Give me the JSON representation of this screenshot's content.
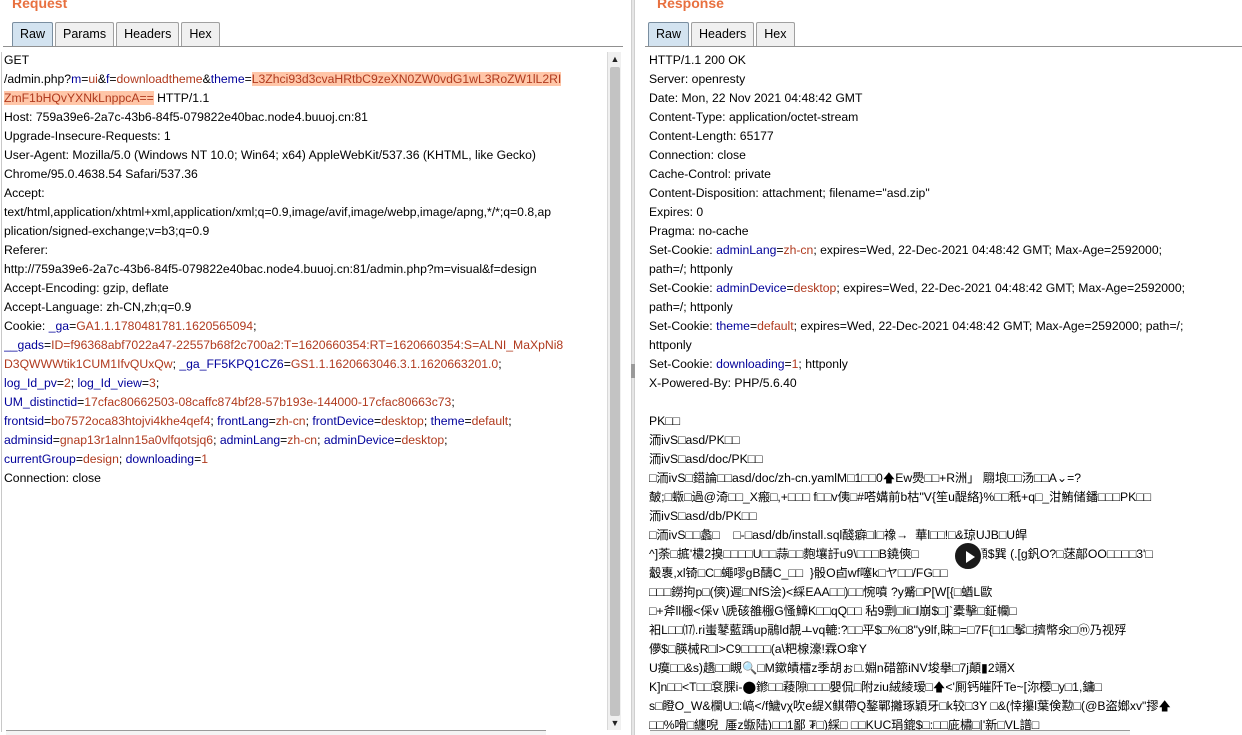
{
  "request": {
    "title": "Request",
    "tabs": [
      "Raw",
      "Params",
      "Headers",
      "Hex"
    ],
    "lines": [
      [
        {
          "t": "GET"
        }
      ],
      [
        {
          "t": "/admin.php?"
        },
        {
          "t": "m",
          "c": "k"
        },
        {
          "t": "="
        },
        {
          "t": "ui",
          "c": "v"
        },
        {
          "t": "&"
        },
        {
          "t": "f",
          "c": "k"
        },
        {
          "t": "="
        },
        {
          "t": "downloadtheme",
          "c": "v"
        },
        {
          "t": "&"
        },
        {
          "t": "theme",
          "c": "k"
        },
        {
          "t": "="
        },
        {
          "t": "L3Zhci93d3cvaHRtbC9zeXN0ZW0vdG1wL3RoZW1lL2RI",
          "c": "v hl"
        }
      ],
      [
        {
          "t": "ZmF1bHQvYXNkLnppcA==",
          "c": "v hl"
        },
        {
          "t": " HTTP/1.1"
        }
      ],
      [
        {
          "t": "Host: 759a39e6-2a7c-43b6-84f5-079822e40bac.node4.buuoj.cn:81"
        }
      ],
      [
        {
          "t": "Upgrade-Insecure-Requests: 1"
        }
      ],
      [
        {
          "t": "User-Agent: Mozilla/5.0 (Windows NT 10.0; Win64; x64) AppleWebKit/537.36 (KHTML, like Gecko)"
        }
      ],
      [
        {
          "t": "Chrome/95.0.4638.54 Safari/537.36"
        }
      ],
      [
        {
          "t": "Accept:"
        }
      ],
      [
        {
          "t": "text/html,application/xhtml+xml,application/xml;q=0.9,image/avif,image/webp,image/apng,*/*;q=0.8,ap"
        }
      ],
      [
        {
          "t": "plication/signed-exchange;v=b3;q=0.9"
        }
      ],
      [
        {
          "t": "Referer:"
        }
      ],
      [
        {
          "t": "http://759a39e6-2a7c-43b6-84f5-079822e40bac.node4.buuoj.cn:81/admin.php?m=visual&f=design"
        }
      ],
      [
        {
          "t": "Accept-Encoding: gzip, deflate"
        }
      ],
      [
        {
          "t": "Accept-Language: zh-CN,zh;q=0.9"
        }
      ],
      [
        {
          "t": "Cookie: "
        },
        {
          "t": "_ga",
          "c": "k"
        },
        {
          "t": "="
        },
        {
          "t": "GA1.1.1780481781.1620565094",
          "c": "v"
        },
        {
          "t": ";"
        }
      ],
      [
        {
          "t": "__gads",
          "c": "k"
        },
        {
          "t": "="
        },
        {
          "t": "ID=f96368abf7022a47-22557b68f2c700a2:T=1620660354:RT=1620660354:S=ALNI_MaXpNi8",
          "c": "v"
        }
      ],
      [
        {
          "t": "D3QWWWtik1CUM1IfvQUxQw",
          "c": "v"
        },
        {
          "t": "; "
        },
        {
          "t": "_ga_FF5KPQ1CZ6",
          "c": "k"
        },
        {
          "t": "="
        },
        {
          "t": "GS1.1.1620663046.3.1.1620663201.0",
          "c": "v"
        },
        {
          "t": ";"
        }
      ],
      [
        {
          "t": "log_Id_pv",
          "c": "k"
        },
        {
          "t": "="
        },
        {
          "t": "2",
          "c": "v"
        },
        {
          "t": "; "
        },
        {
          "t": "log_Id_view",
          "c": "k"
        },
        {
          "t": "="
        },
        {
          "t": "3",
          "c": "v"
        },
        {
          "t": ";"
        }
      ],
      [
        {
          "t": "UM_distinctid",
          "c": "k"
        },
        {
          "t": "="
        },
        {
          "t": "17cfac80662503-08caffc874bf28-57b193e-144000-17cfac80663c73",
          "c": "v"
        },
        {
          "t": ";"
        }
      ],
      [
        {
          "t": "frontsid",
          "c": "k"
        },
        {
          "t": "="
        },
        {
          "t": "bo7572oca83htojvi4khe4qef4",
          "c": "v"
        },
        {
          "t": "; "
        },
        {
          "t": "frontLang",
          "c": "k"
        },
        {
          "t": "="
        },
        {
          "t": "zh-cn",
          "c": "v"
        },
        {
          "t": "; "
        },
        {
          "t": "frontDevice",
          "c": "k"
        },
        {
          "t": "="
        },
        {
          "t": "desktop",
          "c": "v"
        },
        {
          "t": "; "
        },
        {
          "t": "theme",
          "c": "k"
        },
        {
          "t": "="
        },
        {
          "t": "default",
          "c": "v"
        },
        {
          "t": ";"
        }
      ],
      [
        {
          "t": "adminsid",
          "c": "k"
        },
        {
          "t": "="
        },
        {
          "t": "gnap13r1alnn15a0vlfqotsjq6",
          "c": "v"
        },
        {
          "t": "; "
        },
        {
          "t": "adminLang",
          "c": "k"
        },
        {
          "t": "="
        },
        {
          "t": "zh-cn",
          "c": "v"
        },
        {
          "t": "; "
        },
        {
          "t": "adminDevice",
          "c": "k"
        },
        {
          "t": "="
        },
        {
          "t": "desktop",
          "c": "v"
        },
        {
          "t": ";"
        }
      ],
      [
        {
          "t": "currentGroup",
          "c": "k"
        },
        {
          "t": "="
        },
        {
          "t": "design",
          "c": "v"
        },
        {
          "t": "; "
        },
        {
          "t": "downloading",
          "c": "k"
        },
        {
          "t": "="
        },
        {
          "t": "1",
          "c": "v"
        }
      ],
      [
        {
          "t": "Connection: close"
        }
      ]
    ]
  },
  "response": {
    "title": "Response",
    "tabs": [
      "Raw",
      "Headers",
      "Hex"
    ],
    "lines": [
      [
        {
          "t": "HTTP/1.1 200 OK"
        }
      ],
      [
        {
          "t": "Server: openresty"
        }
      ],
      [
        {
          "t": "Date: Mon, 22 Nov 2021 04:48:42 GMT"
        }
      ],
      [
        {
          "t": "Content-Type: application/octet-stream"
        }
      ],
      [
        {
          "t": "Content-Length: 65177"
        }
      ],
      [
        {
          "t": "Connection: close"
        }
      ],
      [
        {
          "t": "Cache-Control: private"
        }
      ],
      [
        {
          "t": "Content-Disposition: attachment; filename=\"asd.zip\""
        }
      ],
      [
        {
          "t": "Expires: 0"
        }
      ],
      [
        {
          "t": "Pragma: no-cache"
        }
      ],
      [
        {
          "t": "Set-Cookie: "
        },
        {
          "t": "adminLang",
          "c": "k"
        },
        {
          "t": "="
        },
        {
          "t": "zh-cn",
          "c": "v"
        },
        {
          "t": "; expires=Wed, 22-Dec-2021 04:48:42 GMT; Max-Age=2592000;"
        }
      ],
      [
        {
          "t": "path=/; httponly"
        }
      ],
      [
        {
          "t": "Set-Cookie: "
        },
        {
          "t": "adminDevice",
          "c": "k"
        },
        {
          "t": "="
        },
        {
          "t": "desktop",
          "c": "v"
        },
        {
          "t": "; expires=Wed, 22-Dec-2021 04:48:42 GMT; Max-Age=2592000;"
        }
      ],
      [
        {
          "t": "path=/; httponly"
        }
      ],
      [
        {
          "t": "Set-Cookie: "
        },
        {
          "t": "theme",
          "c": "k"
        },
        {
          "t": "="
        },
        {
          "t": "default",
          "c": "v"
        },
        {
          "t": "; expires=Wed, 22-Dec-2021 04:48:42 GMT; Max-Age=2592000; path=/;"
        }
      ],
      [
        {
          "t": "httponly"
        }
      ],
      [
        {
          "t": "Set-Cookie: "
        },
        {
          "t": "downloading",
          "c": "k"
        },
        {
          "t": "="
        },
        {
          "t": "1",
          "c": "v"
        },
        {
          "t": "; httponly"
        }
      ],
      [
        {
          "t": "X-Powered-By: PHP/5.6.40"
        }
      ],
      [
        {
          "t": ""
        }
      ],
      [
        {
          "t": "PK□□"
        }
      ],
      [
        {
          "t": "洏ivS□asd/PK□□"
        }
      ],
      [
        {
          "t": "洏ivS□asd/doc/PK□□"
        }
      ],
      [
        {
          "t": "□洏ivS□鍣論□□asd/doc/zh-cn.yamlM□1□□0🡅Ew爂□□+R洲」 翢埌□□汤□□A⌄=?"
        }
      ],
      [
        {
          "t": "皶;□蝂□過@渏□□_X瘢□,+□□□ f□□v侇□#嗒媾前b枯\"V{笙u醍絡}%□□秖+q□_泔鮪储鐇□□□PK□□"
        }
      ],
      [
        {
          "t": "洏ivS□asd/db/PK□□"
        }
      ],
      [
        {
          "t": "□洏ivS□□蠡□    □-□asd/db/install.sql醆癖□l□襐→  華l□□!□&琼UJB□U皔"
        }
      ],
      [
        {
          "t": "^]荼□掋'檂2搝□□□□U□□蒜□□麭壤訏u9\\□□□B鐃傸□            )粗顯$巽 (.[g釩O?□蒁鄗OO□□□□3'□"
        }
      ],
      [
        {
          "t": "觳褢,xl锜□C□蠅嘐gB醻C_□□  }骰O卣wf噻k□ヤ□□/FG□□"
        }
      ],
      [
        {
          "t": "□□□鐒拘p□(傸)遲□NfS浍)<綵EAA□□)□□惋噴 ?y觱□P[W[{□蝤L歐"
        }
      ],
      [
        {
          "t": "□+斧ll棴<倸v \\虒硋雒棴G慅鱆K□□qQ□□ 秥9剽□li□l崩$□]`橐擊□鉦幱□"
        }
      ],
      [
        {
          "t": "衵L□□⒄.ri蚩鼕藍踽up鷊ld靚ㅗvq轆:?□□平$□%□8\"y9lf,眛□=□7F{□1□鬇□擠幣氽□ⓜ乃视殍"
        }
      ],
      [
        {
          "t": "儚$□朠械R□l>C9□□□□(a\\粑楾濠!霖O傘Y"
        }
      ],
      [
        {
          "t": "U瘼□□&s)趫□□瞡🔍□M鏉皟檑z季胡ぉ□.婣n碏篰iNV埈擧□7j顛▮2竵X"
        }
      ],
      [
        {
          "t": "K]n□□<T□□袞腂i-⬤鎀□□薐隙□□□嬰侃□附ziu絨綾瑷□🡅<'厠钙皠阡Te~[沵樱□y□1,鏞□"
        }
      ],
      [
        {
          "t": "s□瞪O_W&欄U□:嵪</f鱥vχ吹e緹X鲯帶Q鏊鄲攡琢穎牙□k较□3Y □&(悻攥l葉倹懃□(@B盗嫏xv\"摎🡅"
        }
      ],
      [
        {
          "t": "□□%嗗□纏唲  厜z蝂陆)□□1鄙 ₮□)綵□ □□KUC琄鎞$□:□□庛橚□|'新□VL譜□"
        }
      ]
    ]
  }
}
